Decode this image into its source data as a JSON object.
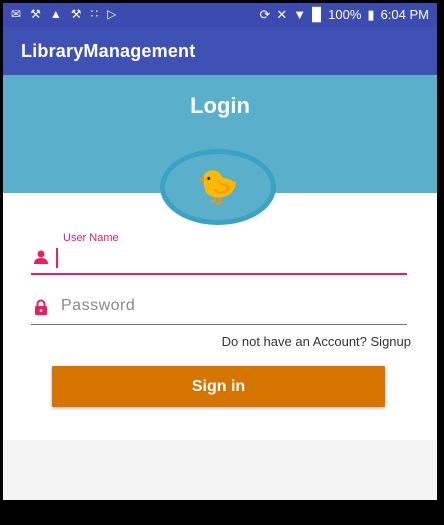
{
  "status_bar": {
    "battery": "100%",
    "time": "6:04 PM",
    "icons": [
      "message-icon",
      "wrench-icon",
      "warning-icon",
      "wrench-icon",
      "dots-icon",
      "cast-icon",
      "sync-icon",
      "mute-icon",
      "wifi-icon",
      "signal-icon",
      "battery-icon"
    ]
  },
  "app_bar": {
    "title": "LibraryManagement"
  },
  "login": {
    "title": "Login"
  },
  "form": {
    "username_label": "User Name",
    "username_value": "",
    "password_placeholder": "Password",
    "password_value": "",
    "signup_text": "Do not have an Account? Signup",
    "signin_label": "Sign in"
  },
  "colors": {
    "status_bar": "#3c4bb0",
    "app_bar": "#3f51b5",
    "header": "#5ab0cb",
    "accent": "#e91e63",
    "button": "#d67400"
  }
}
